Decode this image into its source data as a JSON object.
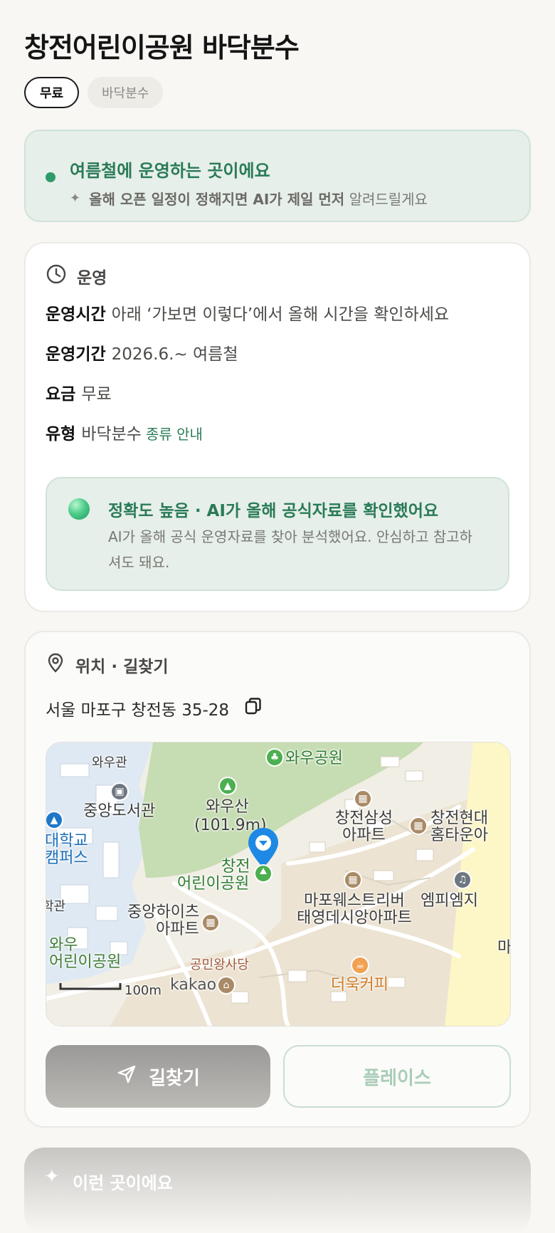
{
  "place": {
    "title": "창전어린이공원 바닥분수",
    "chips": [
      "무료",
      "바닥분수"
    ]
  },
  "season_notice": {
    "headline": "여름철에 운영하는 곳이에요",
    "sub_bold": "올해 오픈 일정이 정해지면 AI가 제일 먼저",
    "sub_rest": "알려드릴게요"
  },
  "operation": {
    "section_title": "운영",
    "rows": [
      {
        "label": "운영시간",
        "value": "아래 ‘가보면 이렇다’에서 올해 시간을 확인하세요"
      },
      {
        "label": "운영기간",
        "value": "2026.6.~ 여름철"
      },
      {
        "label": "요금",
        "value": "무료"
      },
      {
        "label": "유형",
        "value": "바닥분수",
        "link": "종류 안내"
      }
    ],
    "accuracy": {
      "headline": "정확도 높음 · AI가 올해 공식자료를 확인했어요",
      "body": "AI가 올해 공식 운영자료를 찾아 분석했어요. 안심하고 참고하셔도 돼요."
    }
  },
  "location": {
    "section_title": "위치 · 길찾기",
    "address": "서울 마포구 창전동 35-28",
    "map_labels": {
      "wau_gwan": "와우관",
      "central_library": "중앙도서관",
      "campus_1": "대학교",
      "campus_2": "캠퍼스",
      "gwan": "학관",
      "wau_park": "와우공원",
      "wausan_1": "와우산",
      "wausan_2": "(101.9m)",
      "target_1": "창전",
      "target_2": "어린이공원",
      "samsung_1": "창전삼성",
      "samsung_2": "아파트",
      "hyundai_1": "창전현대",
      "hyundai_2": "홈타운아",
      "jungang_1": "중앙하이츠",
      "jungang_2": "아파트",
      "mapo_1": "마포웨스트리버",
      "mapo_2": "태영데시앙아파트",
      "mpi": "엠피엠지",
      "ma": "마",
      "wau_kid_1": "와우",
      "wau_kid_2": "어린이공원",
      "gongmin": "공민왕사당",
      "kakao": "kakao",
      "cafe": "더욱커피",
      "scale": "100m"
    },
    "route_button": "길찾기",
    "place_button": "플레이스"
  },
  "teaser": {
    "title": "이런 곳이에요"
  },
  "colors": {
    "accent_green": "#2a7b57",
    "pin_blue": "#1e88e5"
  }
}
